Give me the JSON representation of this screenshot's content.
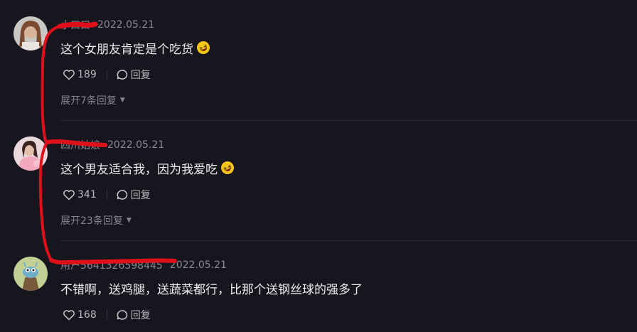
{
  "comments": [
    {
      "username": "小口口",
      "date": "2022.05.21",
      "text": "这个女朋友肯定是个吃货",
      "emoji_icon": "rolling-on-floor-laughing-emoji",
      "likes": "189",
      "reply_label": "回复",
      "expand_label": "展开7条回复"
    },
    {
      "username": "四川姑娘",
      "date": "2022.05.21",
      "text": "这个男友适合我，因为我爱吃",
      "emoji_icon": "rolling-on-floor-laughing-emoji",
      "likes": "341",
      "reply_label": "回复",
      "expand_label": "展开23条回复"
    },
    {
      "username": "用户5641326598445",
      "date": "2022.05.21",
      "text": "不错啊，送鸡腿，送蔬菜都行，比那个送钢丝球的强多了",
      "likes": "168",
      "reply_label": "回复"
    }
  ],
  "colors": {
    "background": "#16161e",
    "annotation_red": "#e0101b"
  }
}
